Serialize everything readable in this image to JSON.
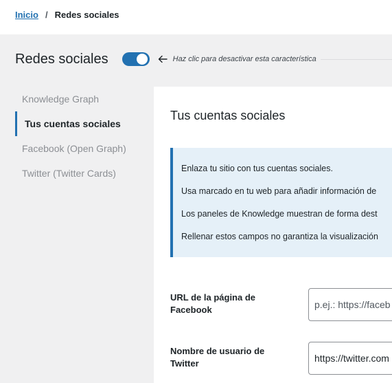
{
  "breadcrumb": {
    "home": "Inicio",
    "separator": "/",
    "current": "Redes sociales"
  },
  "header": {
    "title": "Redes sociales",
    "toggle_on": true,
    "hint": "Haz clic para desactivar esta característica"
  },
  "sidebar": {
    "items": [
      {
        "label": "Knowledge Graph",
        "active": false
      },
      {
        "label": "Tus cuentas sociales",
        "active": true
      },
      {
        "label": "Facebook (Open Graph)",
        "active": false
      },
      {
        "label": "Twitter (Twitter Cards)",
        "active": false
      }
    ]
  },
  "main": {
    "section_title": "Tus cuentas sociales",
    "notice": [
      "Enlaza tu sitio con tus cuentas sociales.",
      "Usa marcado en tu web para añadir información de",
      "Los paneles de Knowledge muestran de forma dest",
      "Rellenar estos campos no garantiza la visualización"
    ],
    "fields": [
      {
        "label": "URL de la página de Facebook",
        "placeholder": "p.ej.: https://faceb",
        "value": ""
      },
      {
        "label": "Nombre de usuario de Twitter",
        "placeholder": "",
        "value": "https://twitter.com"
      }
    ]
  },
  "colors": {
    "accent": "#2271b1",
    "notice_bg": "#e5f0f8",
    "page_bg": "#f0f0f1"
  }
}
